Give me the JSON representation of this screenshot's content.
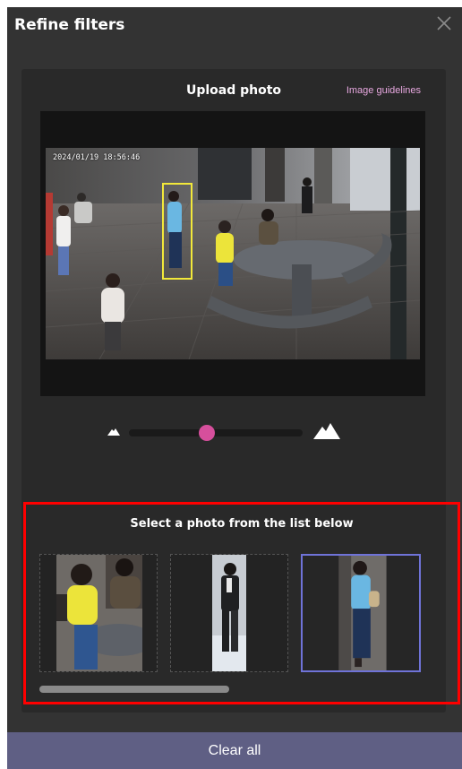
{
  "header": {
    "title": "Refine filters",
    "close_icon": "close-icon"
  },
  "upload": {
    "title": "Upload photo",
    "guidelines_link": "Image guidelines",
    "timestamp": "2024/01/19 18:56:46"
  },
  "slider": {
    "value": 0.45,
    "min_icon": "mountain-small-icon",
    "max_icon": "mountain-large-icon"
  },
  "select": {
    "title": "Select a photo from the list below",
    "photos": [
      {
        "label": "photo-1",
        "selected": false
      },
      {
        "label": "photo-2",
        "selected": false
      },
      {
        "label": "photo-3",
        "selected": true
      }
    ]
  },
  "footer": {
    "clear_label": "Clear all"
  },
  "colors": {
    "accent": "#d64f9c",
    "link": "#e8a8e0",
    "selection_border": "#6f73d8",
    "highlight": "#ff0000",
    "footer_bg": "#5f5f84"
  }
}
